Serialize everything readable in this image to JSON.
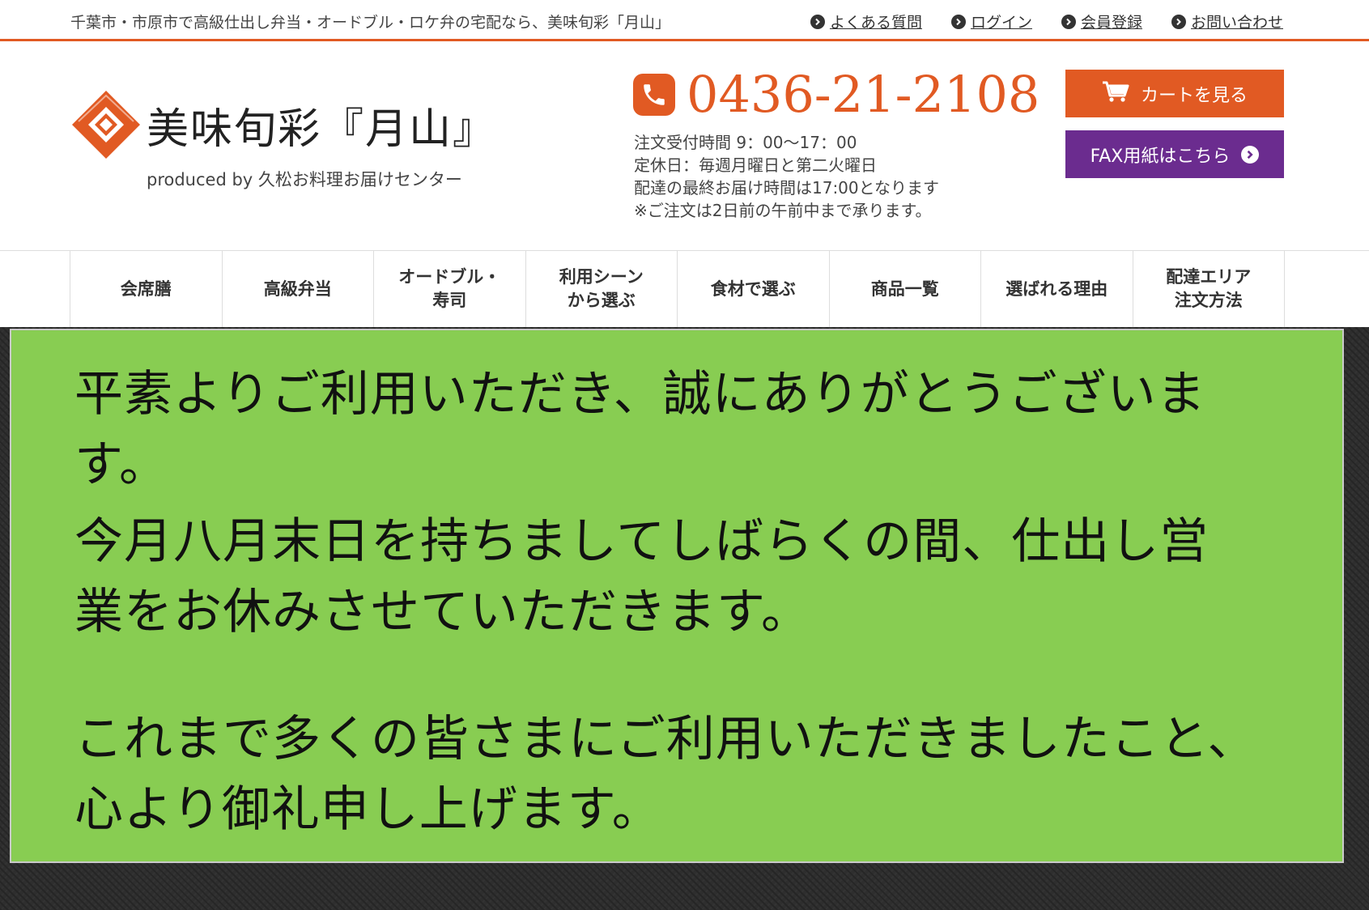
{
  "topbar": {
    "tagline": "千葉市・市原市で高級仕出し弁当・オードブル・ロケ弁の宅配なら、美味旬彩「月山」",
    "links": [
      {
        "label": "よくある質問",
        "icon": "chevron-circle-icon"
      },
      {
        "label": "ログイン",
        "icon": "chevron-circle-icon"
      },
      {
        "label": "会員登録",
        "icon": "chevron-circle-icon"
      },
      {
        "label": "お問い合わせ",
        "icon": "chevron-circle-icon"
      }
    ]
  },
  "header": {
    "logo_title": "美味旬彩『月山』",
    "logo_sub": "produced by 久松お料理お届けセンター",
    "phone": "0436-21-2108",
    "hours": [
      "注文受付時間 9：00〜17：00",
      "定休日：毎週月曜日と第二火曜日",
      "配達の最終お届け時間は17:00となります",
      "※ご注文は2日前の午前中まで承ります。"
    ],
    "cart_label": "カートを見る",
    "fax_label": "FAX用紙はこちら"
  },
  "nav": {
    "items": [
      "会席膳",
      "高級弁当",
      "オードブル・\n寿司",
      "利用シーン\nから選ぶ",
      "食材で選ぶ",
      "商品一覧",
      "選ばれる理由",
      "配達エリア\n注文方法"
    ]
  },
  "notice": {
    "lines": [
      "平素よりご利用いただき、誠にありがとうございま",
      "す。",
      "今月八月末日を持ちましてしばらくの間、仕出し営",
      "業をお休みさせていただきます。",
      "これまで多くの皆さまにご利用いただきましたこと、",
      "心より御礼申し上げます。"
    ]
  },
  "colors": {
    "accent": "#e15a23",
    "fax_button": "#6b2c8f",
    "notice_bg": "#88cd52",
    "main_bg": "#2e2e2e"
  }
}
